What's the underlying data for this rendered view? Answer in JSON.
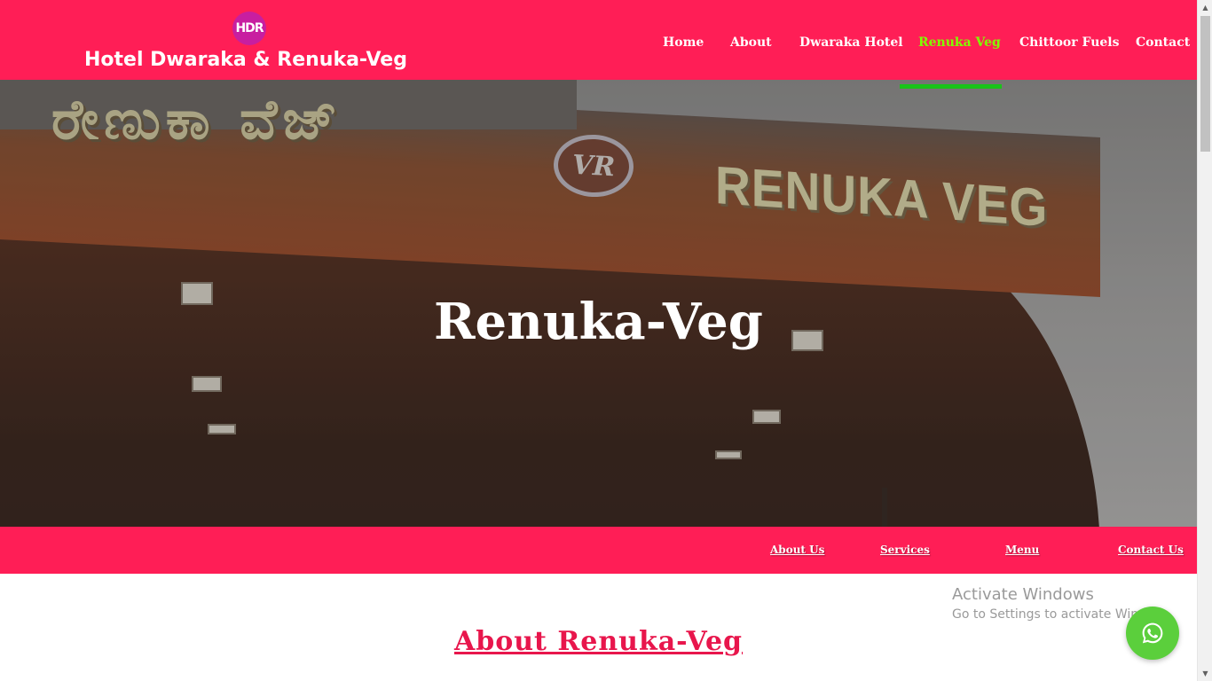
{
  "header": {
    "logo_text": "HDR",
    "brand_name": "Hotel Dwaraka & Renuka-Veg",
    "nav": [
      {
        "label": "Home"
      },
      {
        "label": "About"
      },
      {
        "label": "Dwaraka Hotel"
      },
      {
        "label": "Renuka Veg",
        "active": true
      },
      {
        "label": "Chittoor Fuels"
      },
      {
        "label": "Contact"
      }
    ]
  },
  "hero": {
    "sign_kannada": "ರೇಣುಕಾ ವೆಜ್",
    "sign_emblem": "VR",
    "sign_english": "RENUKA VEG",
    "title": "Renuka-Veg"
  },
  "subnav": [
    {
      "label": "About Us"
    },
    {
      "label": "Services"
    },
    {
      "label": "Menu"
    },
    {
      "label": "Contact Us"
    }
  ],
  "content": {
    "about_heading": "About Renuka-Veg"
  },
  "watermark": {
    "title": "Activate Windows",
    "subtitle": "Go to Settings to activate Windows."
  },
  "whatsapp": {
    "icon": "whatsapp-icon"
  },
  "colors": {
    "brand": "#ff1e56",
    "nav_active": "#7fff00",
    "nav_underline": "#19c419",
    "heading": "#e8164c",
    "whatsapp": "#5bcf3c"
  }
}
